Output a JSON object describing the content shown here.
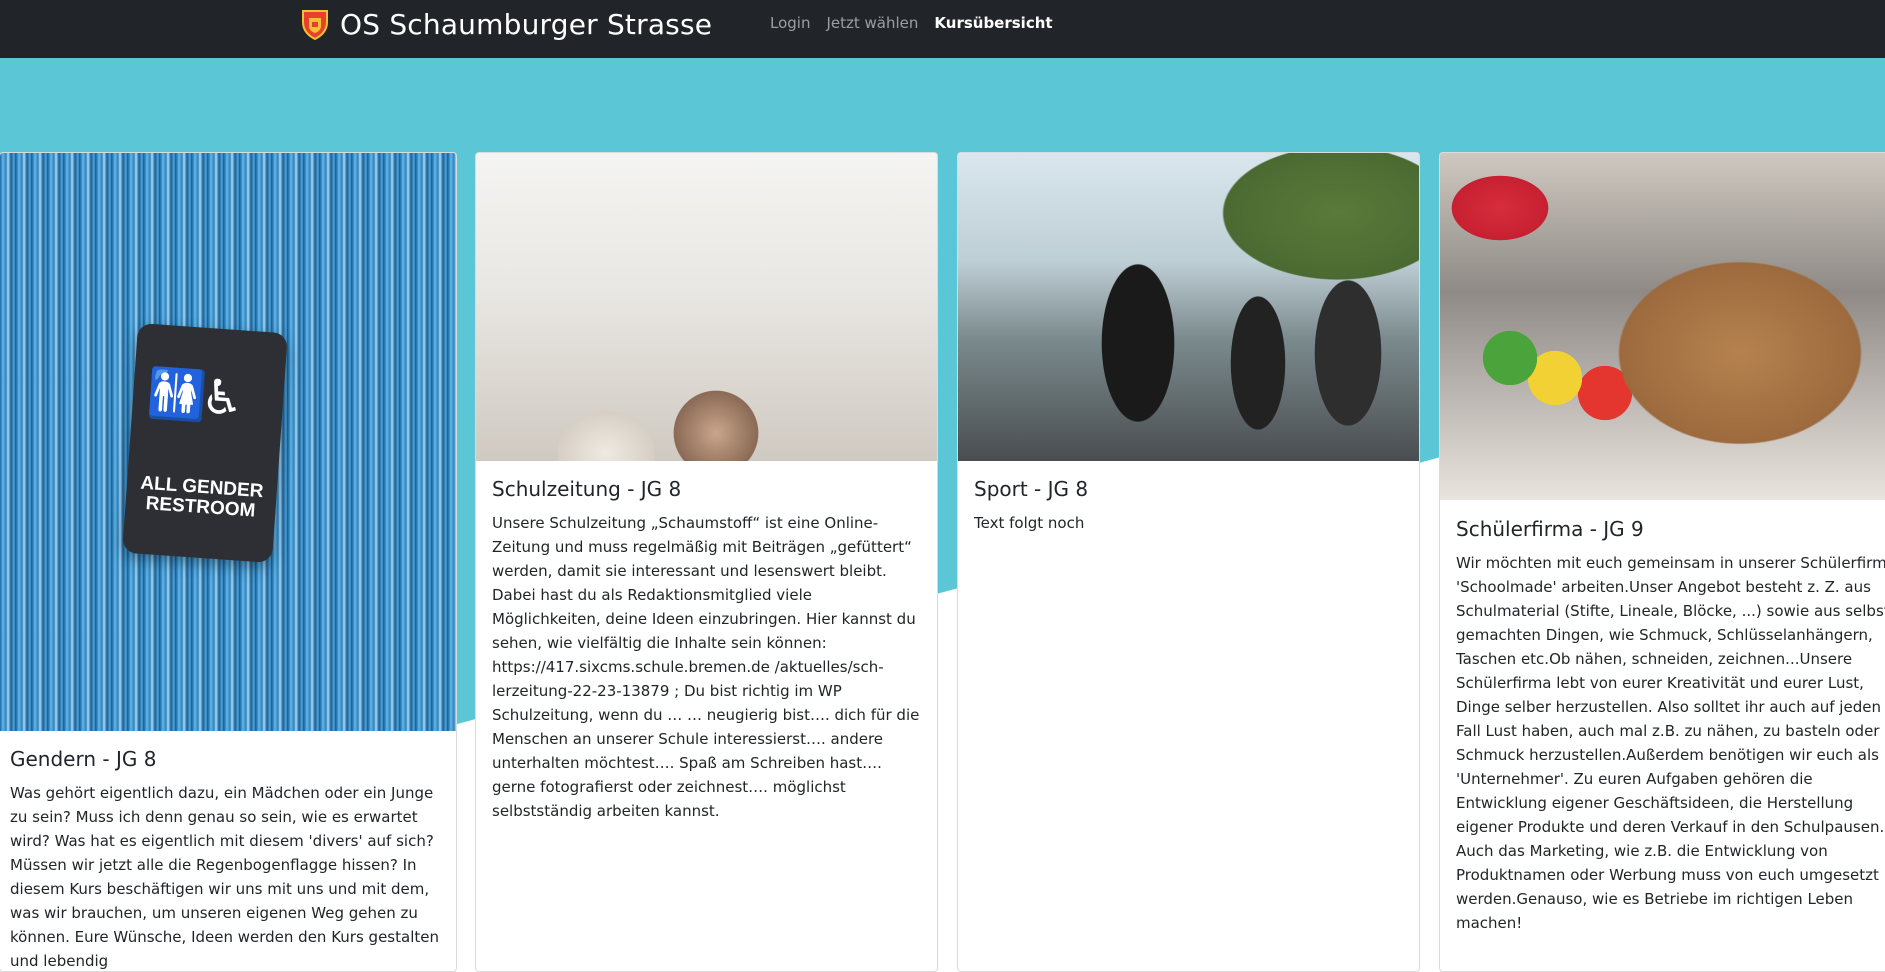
{
  "nav": {
    "brand": "OS Schaumburger Strasse",
    "links": [
      "Login",
      "Jetzt wählen",
      "Kursübersicht"
    ]
  },
  "courses": [
    {
      "title": "Gendern - JG 8",
      "text": "Was gehört eigentlich dazu, ein Mädchen oder ein Junge zu sein? Muss ich denn genau so sein, wie es erwartet wird? Was hat es eigentlich mit diesem 'divers' auf sich? Müssen wir jetzt alle die Regenbogenflagge hissen? In diesem Kurs beschäftigen wir uns mit uns und mit dem, was wir brauchen, um unseren eigenen Weg gehen zu können. Eure Wünsche, Ideen werden den Kurs gestalten und lebendig",
      "image_sign_text": "ALL GENDER RESTROOM"
    },
    {
      "title": "Schulzeitung - JG 8",
      "text": "Unsere Schulzeitung „Schaumstoff“ ist eine Online-Zeitung und muss regelmäßig mit Beiträgen „gefüttert“ werden, damit sie interessant und lesenswert bleibt. Dabei hast du als Redaktionsmitglied viele Möglichkeiten, deine Ideen einzubringen. Hier kannst du sehen, wie vielfältig die Inhalte sein können: https://417.sixcms.schule.bremen.de /aktuelles/sch-lerzeitung-22-23-13879 ; Du bist richtig im WP Schulzeitung, wenn du … … neugierig bist…. dich für die Menschen an unserer Schule interessierst…. andere unterhalten möchtest…. Spaß am Schreiben hast…. gerne fotografierst oder zeichnest…. möglichst selbstständig arbeiten kannst."
    },
    {
      "title": "Sport - JG 8",
      "text": "Text folgt noch"
    },
    {
      "title": "Schülerfirma - JG 9",
      "text": "Wir möchten mit euch gemeinsam in unserer Schülerfirma 'Schoolmade' arbeiten.Unser Angebot besteht z. Z. aus Schulmaterial (Stifte, Lineale, Blöcke, ...) sowie aus selbst gemachten Dingen, wie Schmuck, Schlüsselanhängern, Taschen etc.Ob nähen, schneiden, zeichnen...Unsere Schülerfirma lebt von eurer Kreativität und eurer Lust, Dinge selber herzustellen. Also solltet ihr auch auf jeden Fall Lust haben, auch mal z.B. zu nähen, zu basteln oder Schmuck herzustellen.Außerdem benötigen wir euch als 'Unternehmer'. Zu euren Aufgaben gehören die Entwicklung eigener Geschäftsideen, die Herstellung eigener Produkte und deren Verkauf in den Schulpausen. Auch das Marketing, wie z.B. die Entwicklung von Produktnamen oder Werbung muss von euch umgesetzt werden.Genauso, wie es Betriebe im richtigen Leben machen!"
    }
  ],
  "colors": {
    "navbar": "#212529",
    "hero": "#5bc6d6"
  }
}
